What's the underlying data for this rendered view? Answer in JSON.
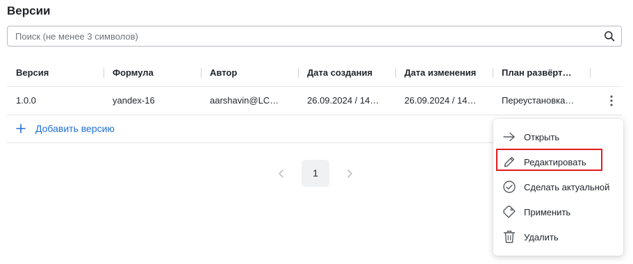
{
  "page": {
    "title": "Версии"
  },
  "search": {
    "placeholder": "Поиск (не менее 3 символов)",
    "value": "",
    "icon": "search-icon"
  },
  "table": {
    "columns": [
      "Версия",
      "Формула",
      "Автор",
      "Дата создания",
      "Дата изменения",
      "План развёрт…"
    ],
    "rows": [
      [
        "1.0.0",
        "yandex-16",
        "aarshavin@LC…",
        "26.09.2024 / 14…",
        "26.09.2024 / 14…",
        "Переустановка…"
      ]
    ],
    "row_actions_icon": "kebab-icon"
  },
  "add_version": {
    "label": "Добавить версию",
    "icon": "plus-icon"
  },
  "pagination": {
    "current_page": "1",
    "prev_icon": "chevron-left-icon",
    "next_icon": "chevron-right-icon"
  },
  "context_menu": {
    "items": [
      {
        "label": "Открыть",
        "icon": "arrow-right-icon"
      },
      {
        "label": "Редактировать",
        "icon": "pencil-icon",
        "highlighted": true
      },
      {
        "label": "Сделать актуальной",
        "icon": "check-circle-icon"
      },
      {
        "label": "Применить",
        "icon": "tag-icon"
      },
      {
        "label": "Удалить",
        "icon": "trash-icon"
      }
    ]
  },
  "colors": {
    "accent": "#1f6fd6",
    "highlight_border": "#e01a1a",
    "text": "#1f2329",
    "pager_active_bg": "#f0f1f3"
  }
}
